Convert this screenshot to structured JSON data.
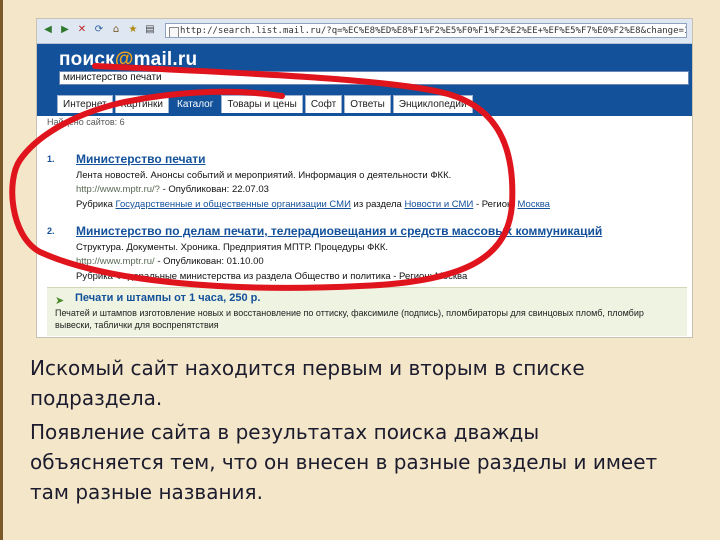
{
  "browser": {
    "address": "http://search.list.mail.ru/?q=%EC%E8%ED%E8%F1%F2%E5%F0%F1%F2%E2%EE+%EF%E5%F7%E0%F2%E8&change=1"
  },
  "search": {
    "logo_text": "поиск",
    "logo_at": "@",
    "logo_domain": "mail.ru",
    "query": "министерство печати",
    "tabs": [
      "Интернет",
      "Картинки",
      "Каталог",
      "Товары и цены",
      "Софт",
      "Ответы",
      "Энциклопедии"
    ],
    "active_tab": "Каталог",
    "found_text": "Найдено сайтов: 6"
  },
  "results": [
    {
      "num": "1.",
      "title": "Министерство печати",
      "line1": "Лента новостей. Анонсы событий и мероприятий. Информация о деятельности ФКК.",
      "url": "http://www.mptr.ru/?",
      "published": "- Опубликован: 22.07.03",
      "rubric_prefix": "Рубрика",
      "rubric": "Государственные и общественные организации СМИ",
      "rubric_mid": "из раздела",
      "section": "Новости и СМИ",
      "region_prefix": "- Регион:",
      "region": "Москва"
    },
    {
      "num": "2.",
      "title": "Министерство по делам печати, телерадиовещания и средств массовых коммуникаций",
      "line1": "Структура. Документы. Хроника. Предприятия МПТР. Процедуры ФКК.",
      "url": "http://www.mptr.ru/",
      "published": "- Опубликован: 01.10.00",
      "rubric_line": "Рубрика Федеральные министерства из раздела Общество и политика - Регион: Москва"
    }
  ],
  "ad": {
    "title": "Печати и штампы от 1 часа, 250 р.",
    "line1": "Печатей и штампов изготовление новых и восстановление по оттиску, факсимиле (подпись), пломбираторы для свинцовых пломб, пломбир",
    "line2": "вывески, таблички для воспрепятствия"
  },
  "caption": {
    "line1": "Искомый сайт находится первым и вторым в списке",
    "line2": "подраздела.",
    "line3": "Появление сайта в результатах поиска дважды",
    "line4": "объясняется тем, что он внесен в разные разделы и имеет",
    "line5": "там разные названия."
  },
  "colors": {
    "slide_background": "#f3e6c9",
    "header_blue": "#13519a",
    "annotation_red": "#e0141c"
  }
}
